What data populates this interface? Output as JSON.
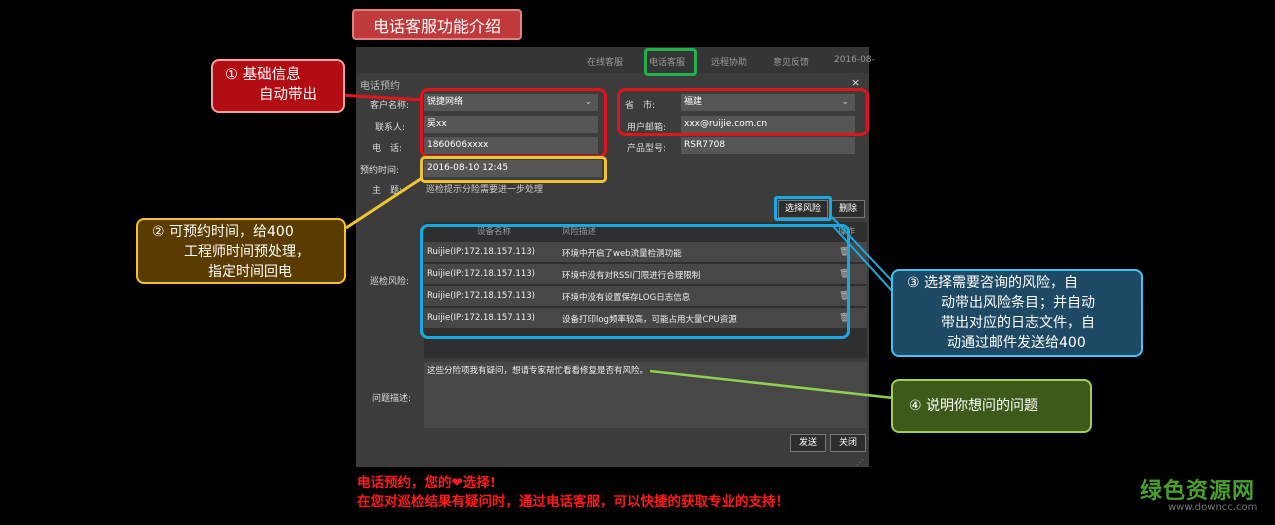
{
  "page_title": "电话客服功能介绍",
  "topbar": {
    "tabs": [
      "在线客服",
      "电话客服",
      "远程协助",
      "意见反馈",
      "2016-08-"
    ]
  },
  "dialog": {
    "title": "电话预约",
    "close": "×",
    "customer_label": "客户名称:",
    "customer_value": "锐捷网络",
    "contact_label": "联系人:",
    "contact_value": "吴xx",
    "phone_label": "电　话:",
    "phone_value": "1860606xxxx",
    "province_label": "省　市:",
    "province_value": "福建",
    "email_label": "用户邮箱:",
    "email_value": "xxx@ruijie.com.cn",
    "model_label": "产品型号:",
    "model_value": "RSR7708",
    "appt_label": "预约时间:",
    "appt_value": "2016-08-10 12:45",
    "topic_label": "主　题:",
    "topic_value": "巡检提示分险需要进一步处理",
    "select_risk_btn": "选择风险",
    "delete_btn": "删除",
    "risk_label": "巡检风险:",
    "risk_headers": [
      "设备名称",
      "风险描述",
      "操作"
    ],
    "risk_rows": [
      {
        "device": "Ruijie(IP:172.18.157.113)",
        "desc": "环境中开启了web流量检测功能"
      },
      {
        "device": "Ruijie(IP:172.18.157.113)",
        "desc": "环境中没有对RSSI门限进行合理限制"
      },
      {
        "device": "Ruijie(IP:172.18.157.113)",
        "desc": "环境中没有设置保存LOG日志信息"
      },
      {
        "device": "Ruijie(IP:172.18.157.113)",
        "desc": "设备打印log频率较高，可能占用大量CPU资源"
      }
    ],
    "problem_label": "问题描述:",
    "problem_value": "这些分险项我有疑问，想请专家帮忙看看修复是否有风险。",
    "send_btn": "发送",
    "close_btn": "关闭"
  },
  "callouts": {
    "c1_line1": "① 基础信息",
    "c1_line2": "自动带出",
    "c2_line1": "② 可预约时间，给400",
    "c2_line2": "工程师时间预处理，",
    "c2_line3": "指定时间回电",
    "c3_line1": "③ 选择需要咨询的风险，自",
    "c3_line2": "动带出风险条目；并自动",
    "c3_line3": "带出对应的日志文件，自",
    "c3_line4": "动通过邮件发送给400",
    "c4": "④ 说明你想问的问题"
  },
  "footer": {
    "line1": "电话预约，您的❤选择!",
    "line2": "在您对巡检结果有疑问时，通过电话客服，可以快捷的获取专业的支持！"
  },
  "watermark": {
    "line1": "绿色资源网",
    "line2": "www.downcc.com"
  },
  "colors": {
    "red": "#e0141c",
    "yellow": "#f1c232",
    "blue": "#1aa8e0",
    "green": "#22b14c"
  }
}
